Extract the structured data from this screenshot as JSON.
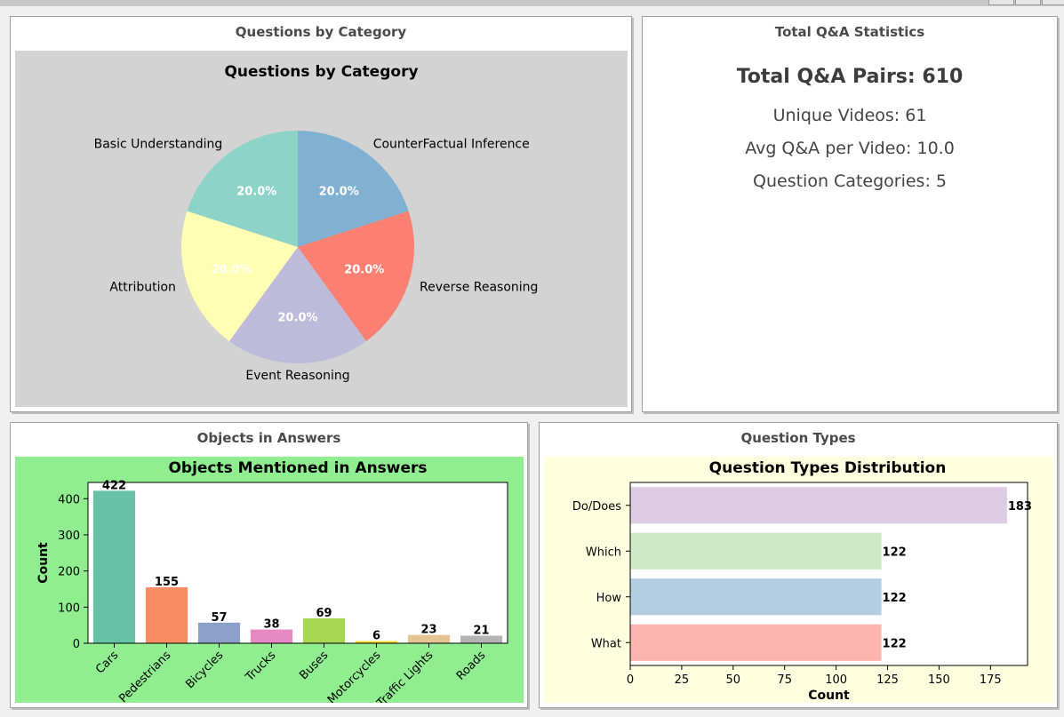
{
  "panels": {
    "category_title": "Questions by Category",
    "stats_title": "Total Q&A Statistics",
    "objects_title": "Objects in Answers",
    "types_title": "Question Types"
  },
  "stats": {
    "total_label": "Total Q&A Pairs: 610",
    "unique_videos": "Unique Videos: 61",
    "avg_per_video": "Avg Q&A per Video: 10.0",
    "categories": "Question Categories: 5"
  },
  "colors": {
    "pie_background": "#d3d3d3",
    "objects_background": "#90ee90",
    "types_background": "#ffffe0"
  },
  "chart_data": [
    {
      "type": "pie",
      "title": "Questions by Category",
      "labels": [
        "CounterFactual Inference",
        "Reverse Reasoning",
        "Event Reasoning",
        "Attribution",
        "Basic Understanding"
      ],
      "values": [
        20.0,
        20.0,
        20.0,
        20.0,
        20.0
      ],
      "pct_labels": [
        "20.0%",
        "20.0%",
        "20.0%",
        "20.0%",
        "20.0%"
      ],
      "colors": [
        "#80b1d3",
        "#fb8072",
        "#bebada",
        "#ffffb3",
        "#8dd3c7"
      ]
    },
    {
      "type": "bar",
      "title": "Objects Mentioned in Answers",
      "categories": [
        "Cars",
        "Pedestrians",
        "Bicycles",
        "Trucks",
        "Buses",
        "Motorcycles",
        "Traffic Lights",
        "Roads"
      ],
      "values": [
        422,
        155,
        57,
        38,
        69,
        6,
        23,
        21
      ],
      "ylabel": "Count",
      "xlabel": "",
      "ylim": [
        0,
        445
      ],
      "yticks": [
        0,
        100,
        200,
        300,
        400
      ],
      "colors": [
        "#66c2a5",
        "#fc8d62",
        "#8da0cb",
        "#e78ac3",
        "#a6d854",
        "#ffd92f",
        "#e5c494",
        "#b3b3b3"
      ]
    },
    {
      "type": "bar",
      "orientation": "horizontal",
      "title": "Question Types Distribution",
      "categories": [
        "Do/Does",
        "Which",
        "How",
        "What"
      ],
      "values": [
        183,
        122,
        122,
        122
      ],
      "xlabel": "Count",
      "ylabel": "",
      "xlim": [
        0,
        193
      ],
      "xticks": [
        0,
        25,
        50,
        75,
        100,
        125,
        150,
        175
      ],
      "colors": [
        "#decbe4",
        "#ccebc5",
        "#b3cde3",
        "#fbb4ae"
      ]
    }
  ]
}
